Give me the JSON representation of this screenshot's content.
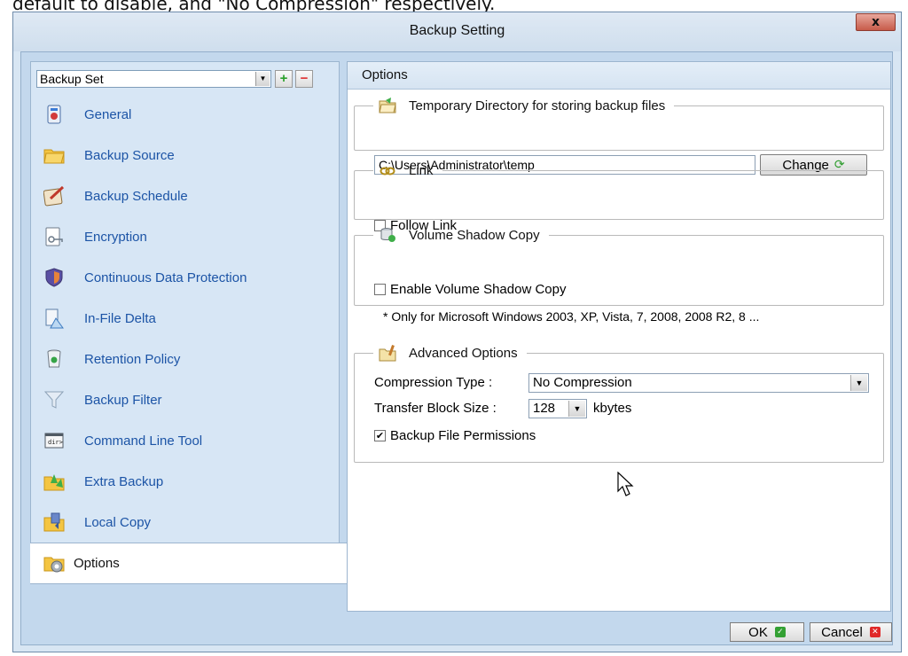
{
  "caption": "default to disable, and \"No Compression\" respectively.",
  "window": {
    "title": "Backup Setting",
    "close_label": "x"
  },
  "sidebar": {
    "backup_set": "Backup Set",
    "add_label": "+",
    "remove_label": "−",
    "items": [
      {
        "label": "General",
        "icon": "general-icon"
      },
      {
        "label": "Backup Source",
        "icon": "folder-icon"
      },
      {
        "label": "Backup Schedule",
        "icon": "schedule-icon"
      },
      {
        "label": "Encryption",
        "icon": "encryption-icon"
      },
      {
        "label": "Continuous Data Protection",
        "icon": "shield-icon"
      },
      {
        "label": "In-File Delta",
        "icon": "delta-icon"
      },
      {
        "label": "Retention Policy",
        "icon": "recycle-bin-icon"
      },
      {
        "label": "Backup Filter",
        "icon": "filter-icon"
      },
      {
        "label": "Command Line Tool",
        "icon": "command-line-icon"
      },
      {
        "label": "Extra Backup",
        "icon": "extra-backup-icon"
      },
      {
        "label": "Local Copy",
        "icon": "local-copy-icon"
      },
      {
        "label": "Options",
        "icon": "options-icon",
        "active": true
      }
    ]
  },
  "options": {
    "header": "Options",
    "temp_dir": {
      "legend": "Temporary Directory for storing backup files",
      "path": "C:\\Users\\Administrator\\temp",
      "change_label": "Change"
    },
    "link": {
      "legend": "Link",
      "follow_label": "Follow Link",
      "follow_checked": false
    },
    "vss": {
      "legend": "Volume Shadow Copy",
      "enable_label": "Enable Volume Shadow Copy",
      "enable_checked": false,
      "note": "* Only for Microsoft Windows 2003, XP, Vista, 7, 2008, 2008 R2, 8 ..."
    },
    "advanced": {
      "legend": "Advanced Options",
      "compression_label": "Compression Type :",
      "compression_value": "No Compression",
      "block_label": "Transfer Block Size :",
      "block_value": "128",
      "block_unit": "kbytes",
      "permissions_label": "Backup File Permissions",
      "permissions_checked": true
    }
  },
  "footer": {
    "ok_label": "OK",
    "cancel_label": "Cancel"
  },
  "colors": {
    "nav_link": "#1c54a6",
    "window_bg": "#d8e6f3",
    "ok_green": "#33a033",
    "cancel_red": "#e02828"
  }
}
